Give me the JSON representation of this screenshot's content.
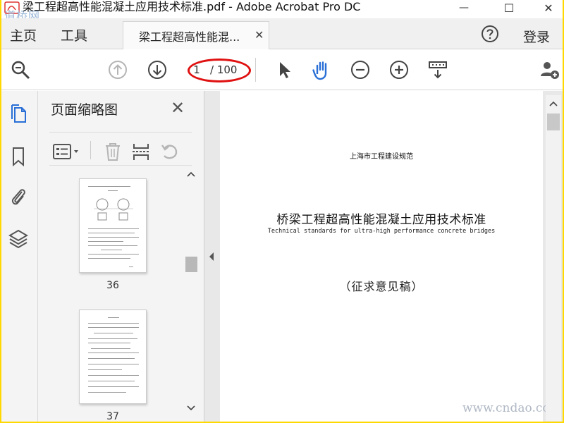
{
  "window": {
    "title": "梁工程超高性能混凝土应用技术标准.pdf - Adobe Acrobat Pro DC",
    "watermark_logo": "道桥网",
    "close_glyph": "✕",
    "maximize_glyph": "☐",
    "minimize_glyph": "—"
  },
  "tabbar": {
    "home": "主页",
    "tools": "工具",
    "doc_tab": "梁工程超高性能混...",
    "doc_tab_close": "✕",
    "login": "登录"
  },
  "toolbar": {
    "current_page": "1",
    "total_pages": "/ 100",
    "highlight_color": "#e01010"
  },
  "panel": {
    "title": "页面缩略图",
    "close": "✕",
    "thumbnails": [
      {
        "page_number": "36"
      },
      {
        "page_number": "37"
      }
    ]
  },
  "document": {
    "header": "上海市工程建设规范",
    "title": "桥梁工程超高性能混凝土应用技术标准",
    "subtitle": "Technical standards for ultra-high performance concrete bridges",
    "status": "（征求意见稿）",
    "site_watermark": "www.cndao.com"
  },
  "colors": {
    "accent_blue": "#2a6fd6",
    "icon_gray": "#555555",
    "disabled_gray": "#b5b5b5"
  }
}
